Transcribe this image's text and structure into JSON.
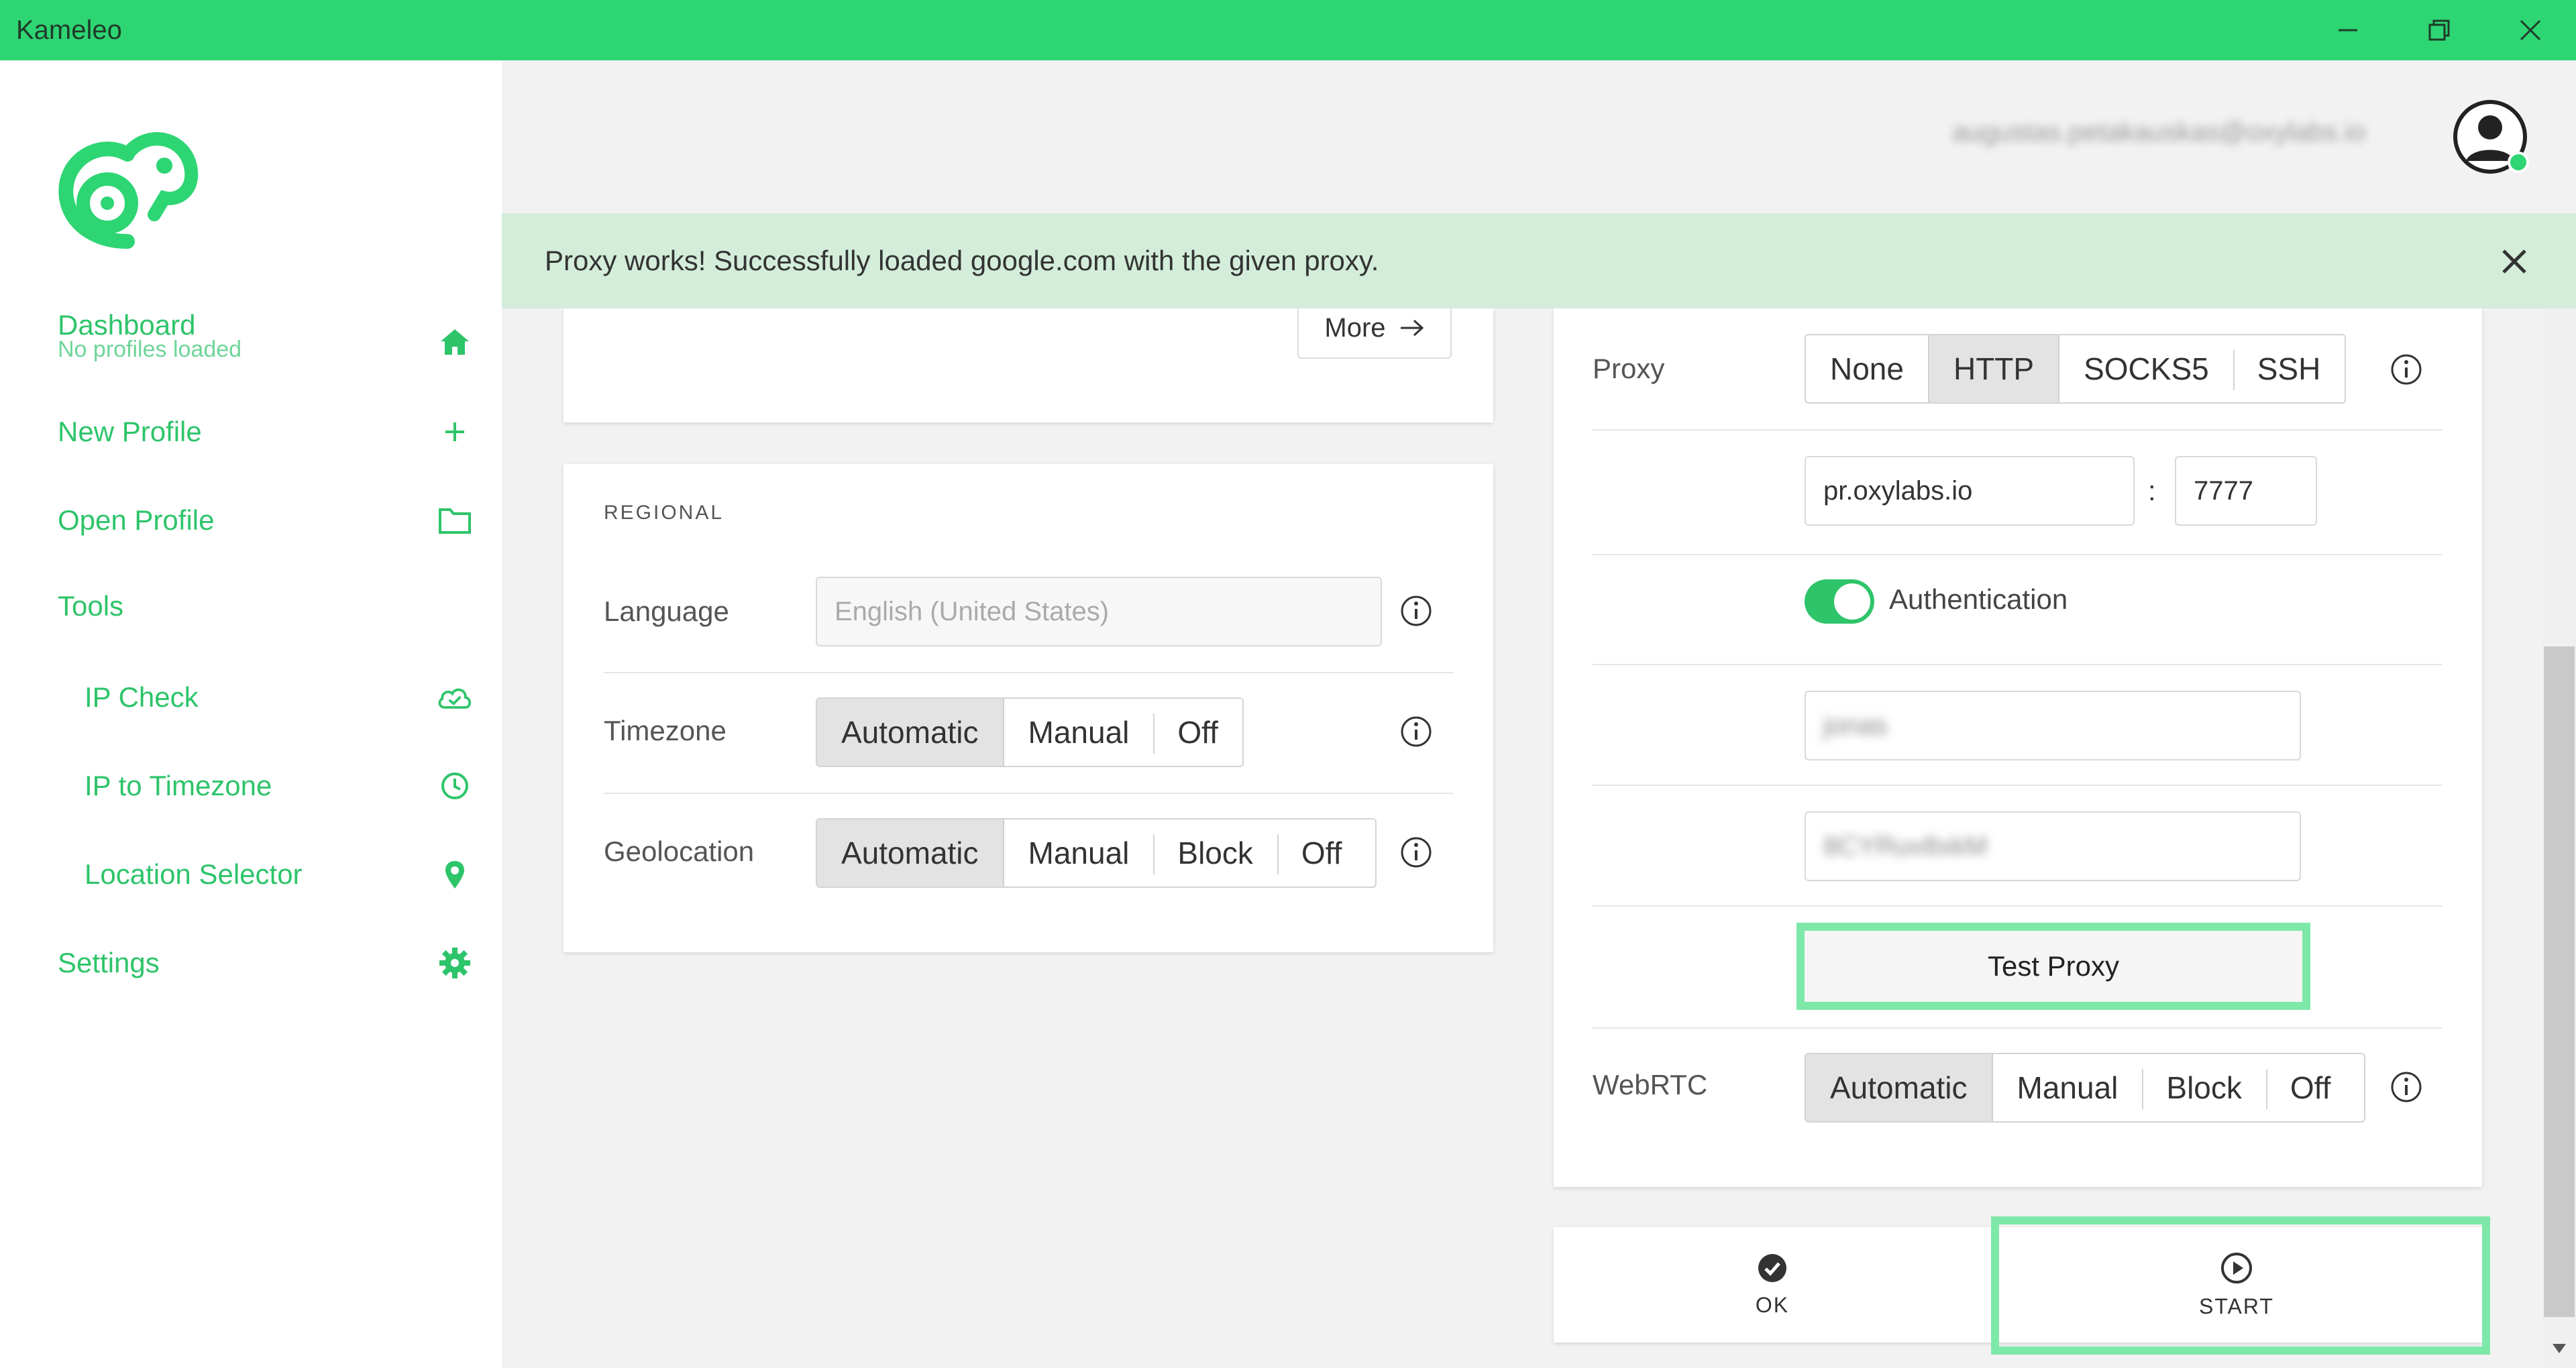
{
  "window": {
    "title": "Kameleo"
  },
  "user": {
    "email": "augustas.petakauskas@oxylabs.io"
  },
  "sidebar": {
    "dashboard": {
      "label": "Dashboard",
      "sub": "No profiles loaded"
    },
    "new_profile": "New Profile",
    "open_profile": "Open Profile",
    "tools": "Tools",
    "ip_check": "IP Check",
    "ip_to_timezone": "IP to Timezone",
    "location_selector": "Location Selector",
    "settings": "Settings"
  },
  "banner": {
    "message": "Proxy works! Successfully loaded google.com with the given proxy."
  },
  "top_card": {
    "more_label": "More"
  },
  "regional": {
    "section_title": "REGIONAL",
    "language": {
      "label": "Language",
      "placeholder": "English (United States)"
    },
    "timezone": {
      "label": "Timezone",
      "options": [
        "Automatic",
        "Manual",
        "Off"
      ],
      "selected": "Automatic"
    },
    "geolocation": {
      "label": "Geolocation",
      "options": [
        "Automatic",
        "Manual",
        "Block",
        "Off"
      ],
      "selected": "Automatic"
    }
  },
  "network": {
    "proxy": {
      "label": "Proxy",
      "options": [
        "None",
        "HTTP",
        "SOCKS5",
        "SSH"
      ],
      "selected": "HTTP"
    },
    "host": "pr.oxylabs.io",
    "port_sep": ":",
    "port": "7777",
    "auth_label": "Authentication",
    "auth_enabled": true,
    "username": "jonas",
    "password": "8CYRuv8xkM",
    "test_proxy_label": "Test Proxy",
    "webrtc": {
      "label": "WebRTC",
      "options": [
        "Automatic",
        "Manual",
        "Block",
        "Off"
      ],
      "selected": "Automatic"
    }
  },
  "actions": {
    "ok_label": "OK",
    "start_label": "START"
  },
  "colors": {
    "brand_green": "#2ed573",
    "nav_green": "#2ec46a",
    "banner_bg": "#d3edda",
    "highlight": "#7de8a8"
  }
}
